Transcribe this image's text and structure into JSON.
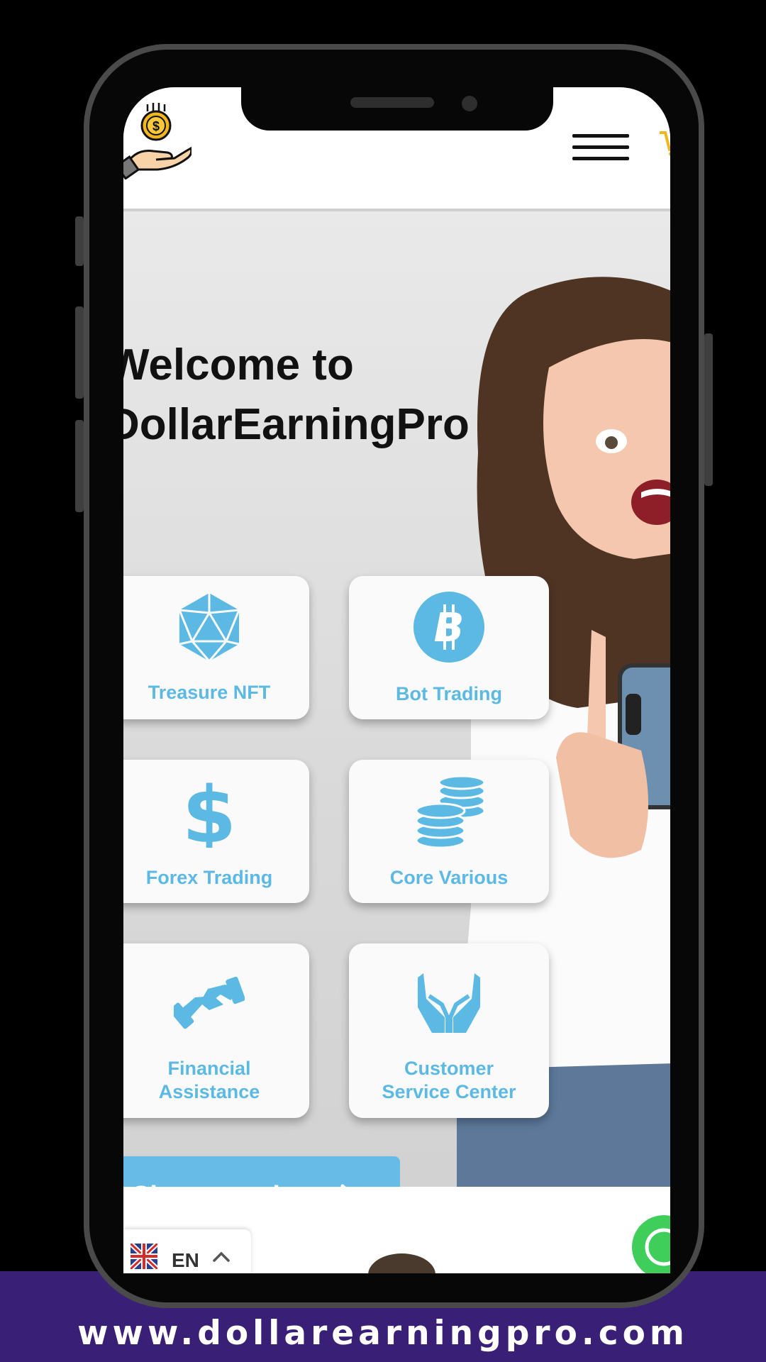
{
  "header": {
    "logo_name": "hand-coin-logo",
    "menu_label": "menu"
  },
  "hero": {
    "title_line1": "Welcome to",
    "title_line2": "DollarEarningPro"
  },
  "features": [
    {
      "label": "Treasure NFT",
      "icon": "d20-polyhedron-icon"
    },
    {
      "label": "Bot Trading",
      "icon": "bitcoin-icon"
    },
    {
      "label": "Forex Trading",
      "icon": "dollar-sign-icon"
    },
    {
      "label": "Core Various",
      "icon": "coin-stack-icon"
    },
    {
      "label_line1": "Financial",
      "label_line2": "Assistance",
      "icon": "handshake-icon"
    },
    {
      "label_line1": "Customer",
      "label_line2": "Service Center",
      "icon": "open-hands-icon"
    }
  ],
  "signup": {
    "label": "Sign up today"
  },
  "language": {
    "code": "EN"
  },
  "banner": {
    "url": "www.dollarearningpro.com"
  },
  "colors": {
    "accent": "#5cb9e4",
    "button": "#66bce6",
    "banner": "#3a1f77",
    "whatsapp": "#3fce5a"
  }
}
